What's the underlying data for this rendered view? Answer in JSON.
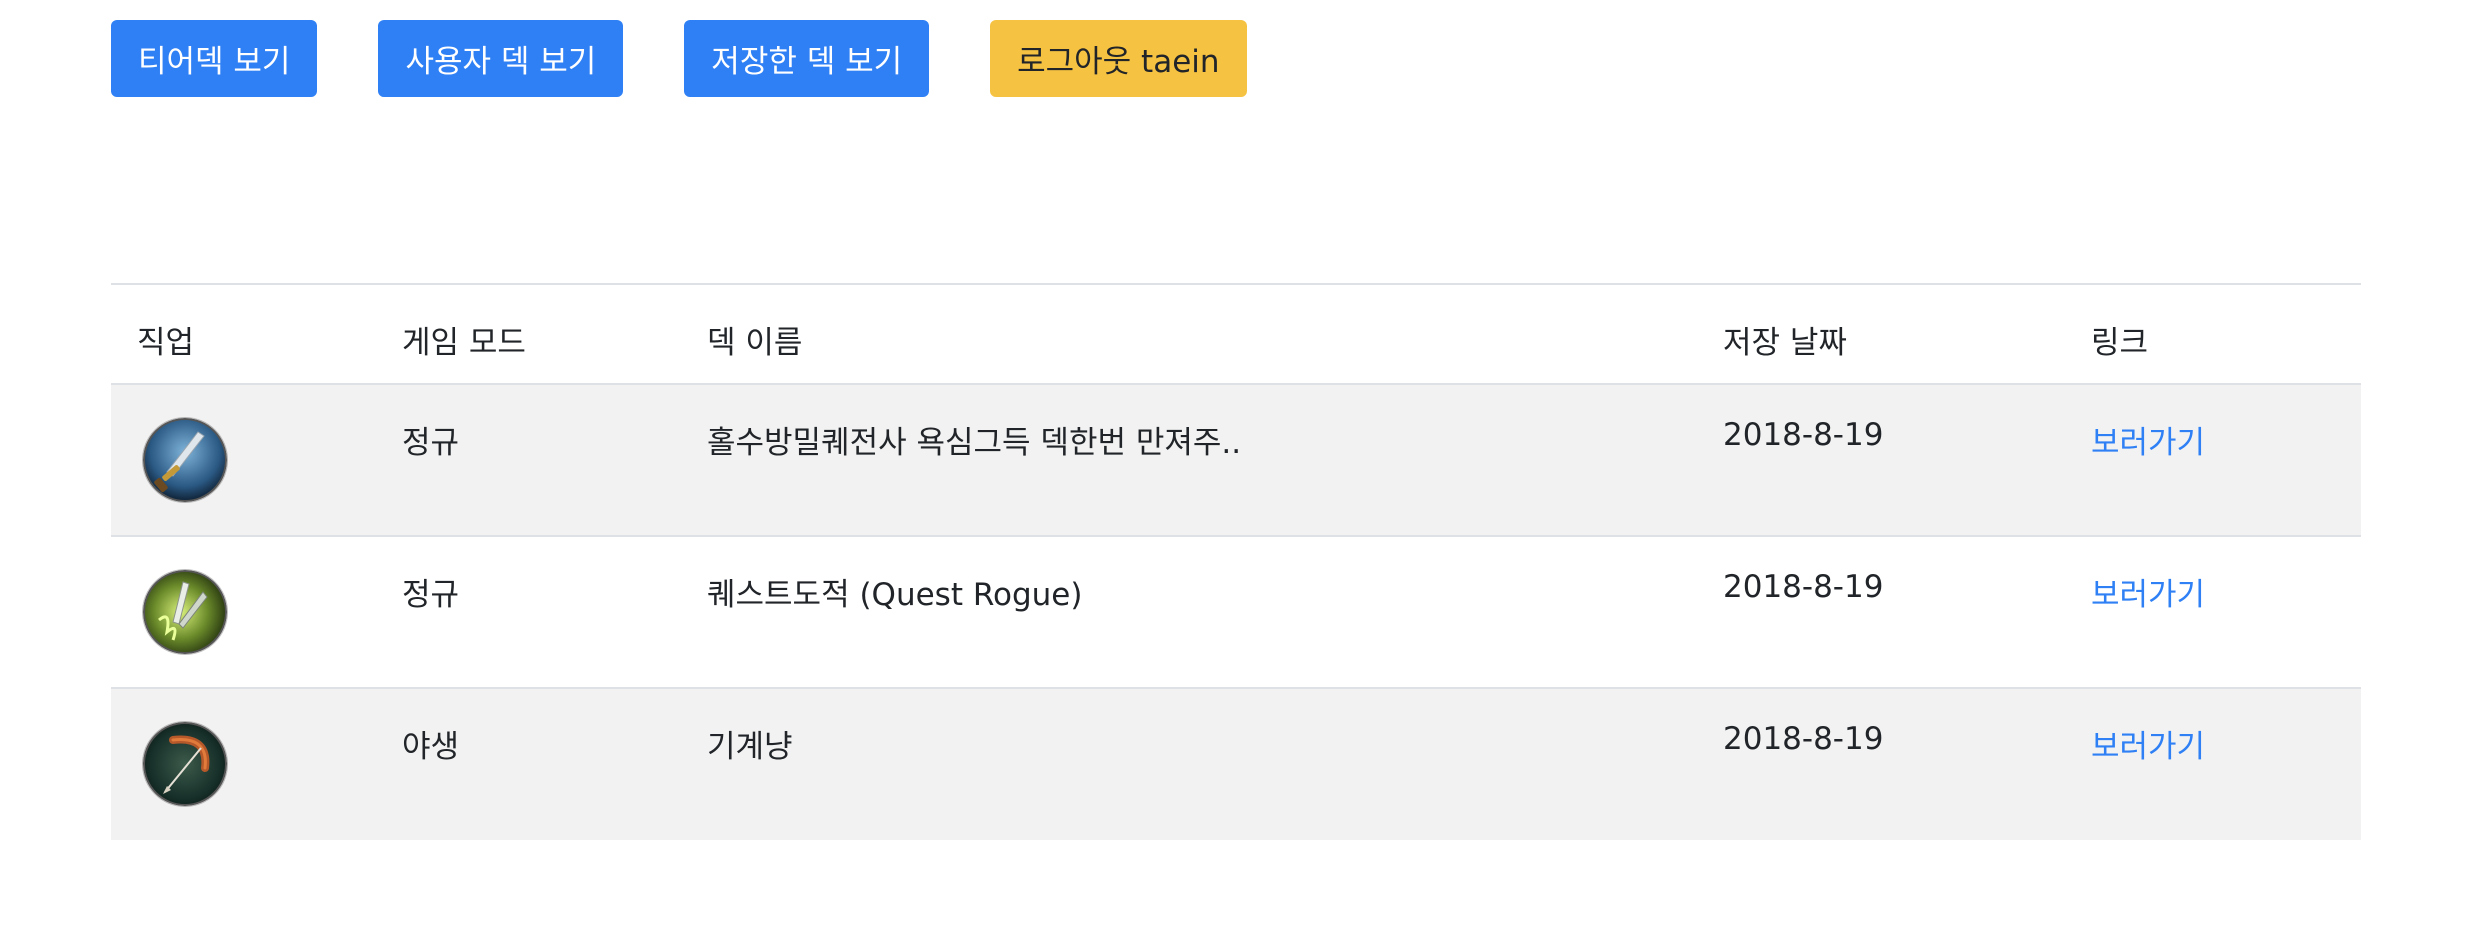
{
  "toolbar": {
    "tier_decks_label": "티어덱 보기",
    "user_decks_label": "사용자 덱 보기",
    "saved_decks_label": "저장한 덱 보기",
    "logout_label": "로그아웃 taein"
  },
  "table": {
    "headers": {
      "class": "직업",
      "game_mode": "게임 모드",
      "deck_name": "덱 이름",
      "saved_date": "저장 날짜",
      "link": "링크"
    },
    "rows": [
      {
        "class_icon": "warrior-icon",
        "game_mode": "정규",
        "deck_name": "홀수방밀퀘전사 욕심그득 덱한번 만져주..",
        "saved_date": "2018-8-19",
        "link_label": "보러가기"
      },
      {
        "class_icon": "rogue-icon",
        "game_mode": "정규",
        "deck_name": "퀘스트도적 (Quest Rogue)",
        "saved_date": "2018-8-19",
        "link_label": "보러가기"
      },
      {
        "class_icon": "hunter-icon",
        "game_mode": "야생",
        "deck_name": "기계냥",
        "saved_date": "2018-8-19",
        "link_label": "보러가기"
      }
    ]
  },
  "colors": {
    "primary": "#2f80f5",
    "warning": "#f6c242",
    "stripe": "#f2f2f2",
    "border": "#dee2e6"
  }
}
